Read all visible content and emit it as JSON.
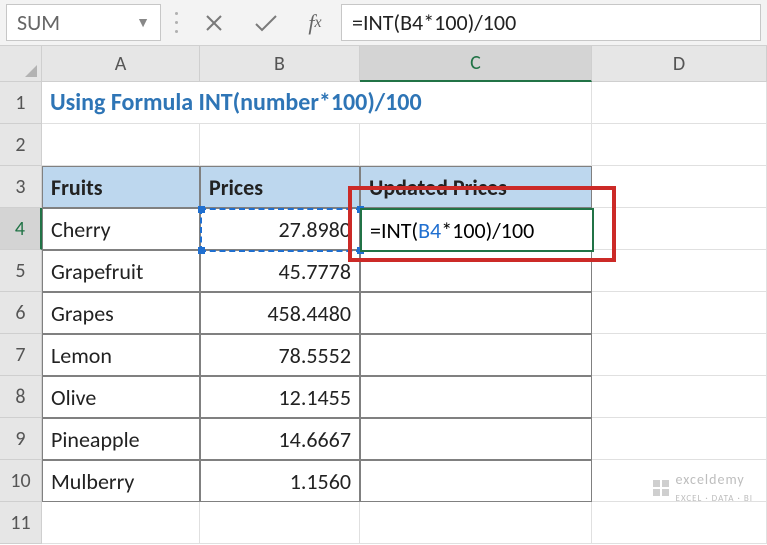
{
  "name_box": {
    "value": "SUM"
  },
  "formula_bar": {
    "value": "=INT(B4*100)/100"
  },
  "columns": [
    {
      "letter": "A",
      "width_class": "wA"
    },
    {
      "letter": "B",
      "width_class": "wB"
    },
    {
      "letter": "C",
      "width_class": "wC",
      "active": true
    },
    {
      "letter": "D",
      "width_class": "wD"
    }
  ],
  "row_numbers": [
    "1",
    "2",
    "3",
    "4",
    "5",
    "6",
    "7",
    "8",
    "9",
    "10",
    "11"
  ],
  "active_row": "4",
  "title": "Using Formula INT(number*100)/100",
  "table": {
    "headers": {
      "a": "Fruits",
      "b": "Prices",
      "c": "Updated Prices"
    },
    "rows": [
      {
        "a": "Cherry",
        "b": "27.8980"
      },
      {
        "a": "Grapefruit",
        "b": "45.7778"
      },
      {
        "a": "Grapes",
        "b": "458.4480"
      },
      {
        "a": "Lemon",
        "b": "78.5552"
      },
      {
        "a": "Olive",
        "b": "12.1455"
      },
      {
        "a": "Pineapple",
        "b": "14.6667"
      },
      {
        "a": "Mulberry",
        "b": "1.1560"
      }
    ]
  },
  "editing_cell": {
    "prefix": "=INT(",
    "ref": "B4",
    "suffix": "*100)/100"
  },
  "watermark": {
    "brand": "exceldemy",
    "tag": "EXCEL · DATA · BI"
  },
  "chart_data": {
    "type": "table",
    "title": "Using Formula INT(number*100)/100",
    "columns": [
      "Fruits",
      "Prices",
      "Updated Prices"
    ],
    "rows": [
      [
        "Cherry",
        27.898,
        null
      ],
      [
        "Grapefruit",
        45.7778,
        null
      ],
      [
        "Grapes",
        458.448,
        null
      ],
      [
        "Lemon",
        78.5552,
        null
      ],
      [
        "Olive",
        12.1455,
        null
      ],
      [
        "Pineapple",
        14.6667,
        null
      ],
      [
        "Mulberry",
        1.156,
        null
      ]
    ],
    "editing_formula_cell": "C4",
    "editing_formula": "=INT(B4*100)/100"
  }
}
